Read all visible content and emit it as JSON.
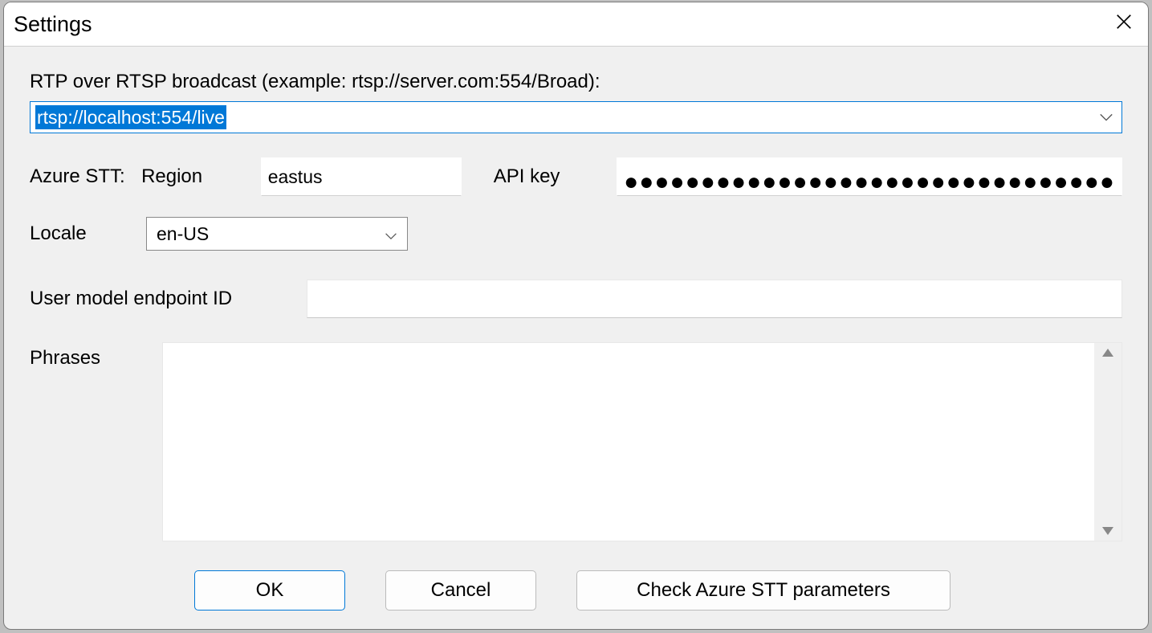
{
  "dialog": {
    "title": "Settings"
  },
  "rtsp": {
    "label": "RTP over RTSP broadcast (example: rtsp://server.com:554/Broad):",
    "value": "rtsp://localhost:554/live"
  },
  "azure": {
    "stt_label": "Azure STT:",
    "region_label": "Region",
    "region_value": "eastus",
    "api_label": "API key",
    "api_value": "●●●●●●●●●●●●●●●●●●●●●●●●●●●●●●●●"
  },
  "locale": {
    "label": "Locale",
    "value": "en-US"
  },
  "endpoint": {
    "label": "User model endpoint ID",
    "value": ""
  },
  "phrases": {
    "label": "Phrases",
    "value": ""
  },
  "buttons": {
    "ok": "OK",
    "cancel": "Cancel",
    "check": "Check Azure STT parameters"
  }
}
